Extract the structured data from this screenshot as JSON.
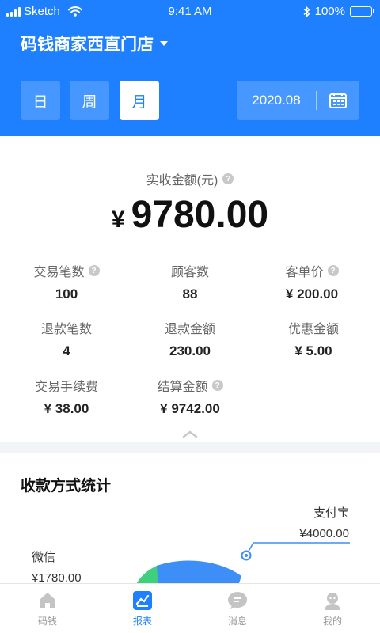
{
  "status_bar": {
    "carrier": "Sketch",
    "time": "9:41 AM",
    "battery": "100%"
  },
  "header": {
    "store_name": "码钱商家西直门店"
  },
  "period_tabs": [
    {
      "label": "日",
      "active": false
    },
    {
      "label": "周",
      "active": false
    },
    {
      "label": "月",
      "active": true
    }
  ],
  "date_picker": {
    "value": "2020.08"
  },
  "summary": {
    "total_label": "实收金额(元)",
    "total_currency": "¥",
    "total_value": "9780.00",
    "stats": [
      {
        "label": "交易笔数",
        "value": "100",
        "help": true
      },
      {
        "label": "顾客数",
        "value": "88",
        "help": false
      },
      {
        "label": "客单价",
        "value": "¥ 200.00",
        "help": true
      },
      {
        "label": "退款笔数",
        "value": "4",
        "help": false
      },
      {
        "label": "退款金额",
        "value": "230.00",
        "help": false
      },
      {
        "label": "优惠金额",
        "value": "¥ 5.00",
        "help": false
      },
      {
        "label": "交易手续费",
        "value": "¥ 38.00",
        "help": false
      },
      {
        "label": "结算金额",
        "value": "¥ 9742.00",
        "help": true
      }
    ]
  },
  "payment": {
    "title": "收款方式统计",
    "methods": [
      {
        "name": "支付宝",
        "amount": "¥4000.00",
        "color": "#3d8ef7"
      },
      {
        "name": "微信",
        "amount": "¥1780.00",
        "color": "#3fcf7d"
      }
    ]
  },
  "tabbar": {
    "items": [
      {
        "label": "码钱",
        "icon": "home-icon",
        "active": false
      },
      {
        "label": "报表",
        "icon": "report-icon",
        "active": true
      },
      {
        "label": "消息",
        "icon": "message-icon",
        "active": false
      },
      {
        "label": "我的",
        "icon": "profile-icon",
        "active": false
      }
    ]
  },
  "colors": {
    "primary": "#1e80ff",
    "alipay": "#3d8ef7",
    "wechat": "#3fcf7d"
  }
}
